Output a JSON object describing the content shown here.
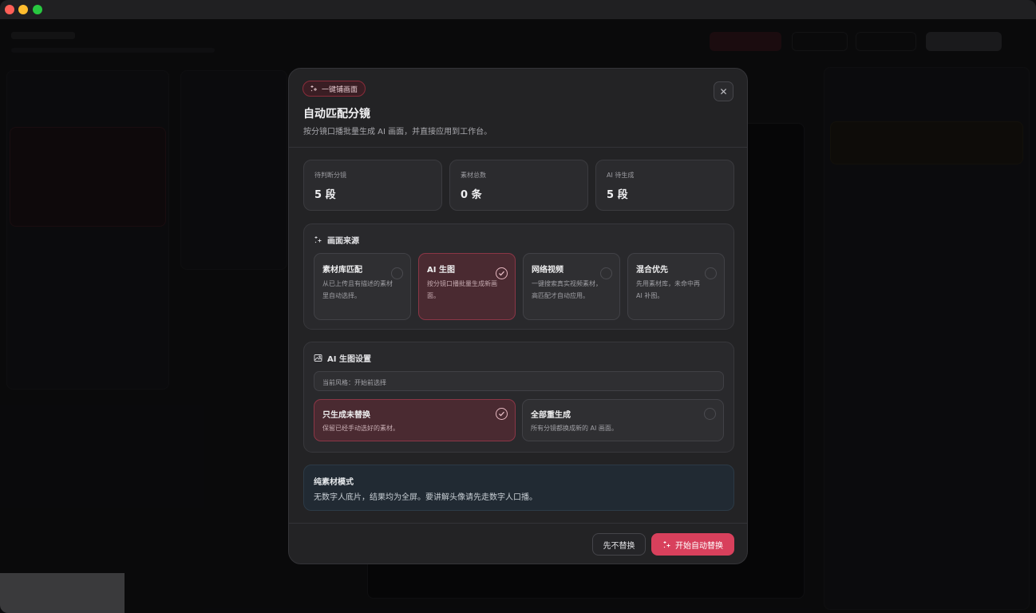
{
  "modal": {
    "tag": "一键铺画面",
    "title": "自动匹配分镜",
    "subtitle": "按分镜口播批量生成 AI 画面，并直接应用到工作台。",
    "close_icon": "close-icon",
    "stats": [
      {
        "label": "待判断分镜",
        "value": "5 段"
      },
      {
        "label": "素材总数",
        "value": "0 条"
      },
      {
        "label": "AI 待生成",
        "value": "5 段"
      }
    ],
    "source": {
      "title": "画面来源",
      "options": [
        {
          "title": "素材库匹配",
          "desc": "从已上传且有描述的素材里自动选择。",
          "selected": false
        },
        {
          "title": "AI 生图",
          "desc": "按分镜口播批量生成新画面。",
          "selected": true
        },
        {
          "title": "网络视频",
          "desc": "一键搜索真实视频素材，高匹配才自动应用。",
          "selected": false
        },
        {
          "title": "混合优先",
          "desc": "先用素材库，未命中再 AI 补图。",
          "selected": false
        }
      ]
    },
    "ai_settings": {
      "title": "AI 生图设置",
      "style_text": "当前风格：开始前选择",
      "modes": [
        {
          "title": "只生成未替换",
          "desc": "保留已经手动选好的素材。",
          "selected": true
        },
        {
          "title": "全部重生成",
          "desc": "所有分镜都换成新的 AI 画面。",
          "selected": false
        }
      ]
    },
    "info": {
      "title": "纯素材模式",
      "text": "无数字人底片，结果均为全屏。要讲解头像请先走数字人口播。"
    },
    "footer": {
      "cancel_label": "先不替换",
      "confirm_label": "开始自动替换"
    }
  },
  "colors": {
    "accent": "#d8405c",
    "selected_bg": "#4a2a31",
    "selected_border": "#8b3646"
  }
}
